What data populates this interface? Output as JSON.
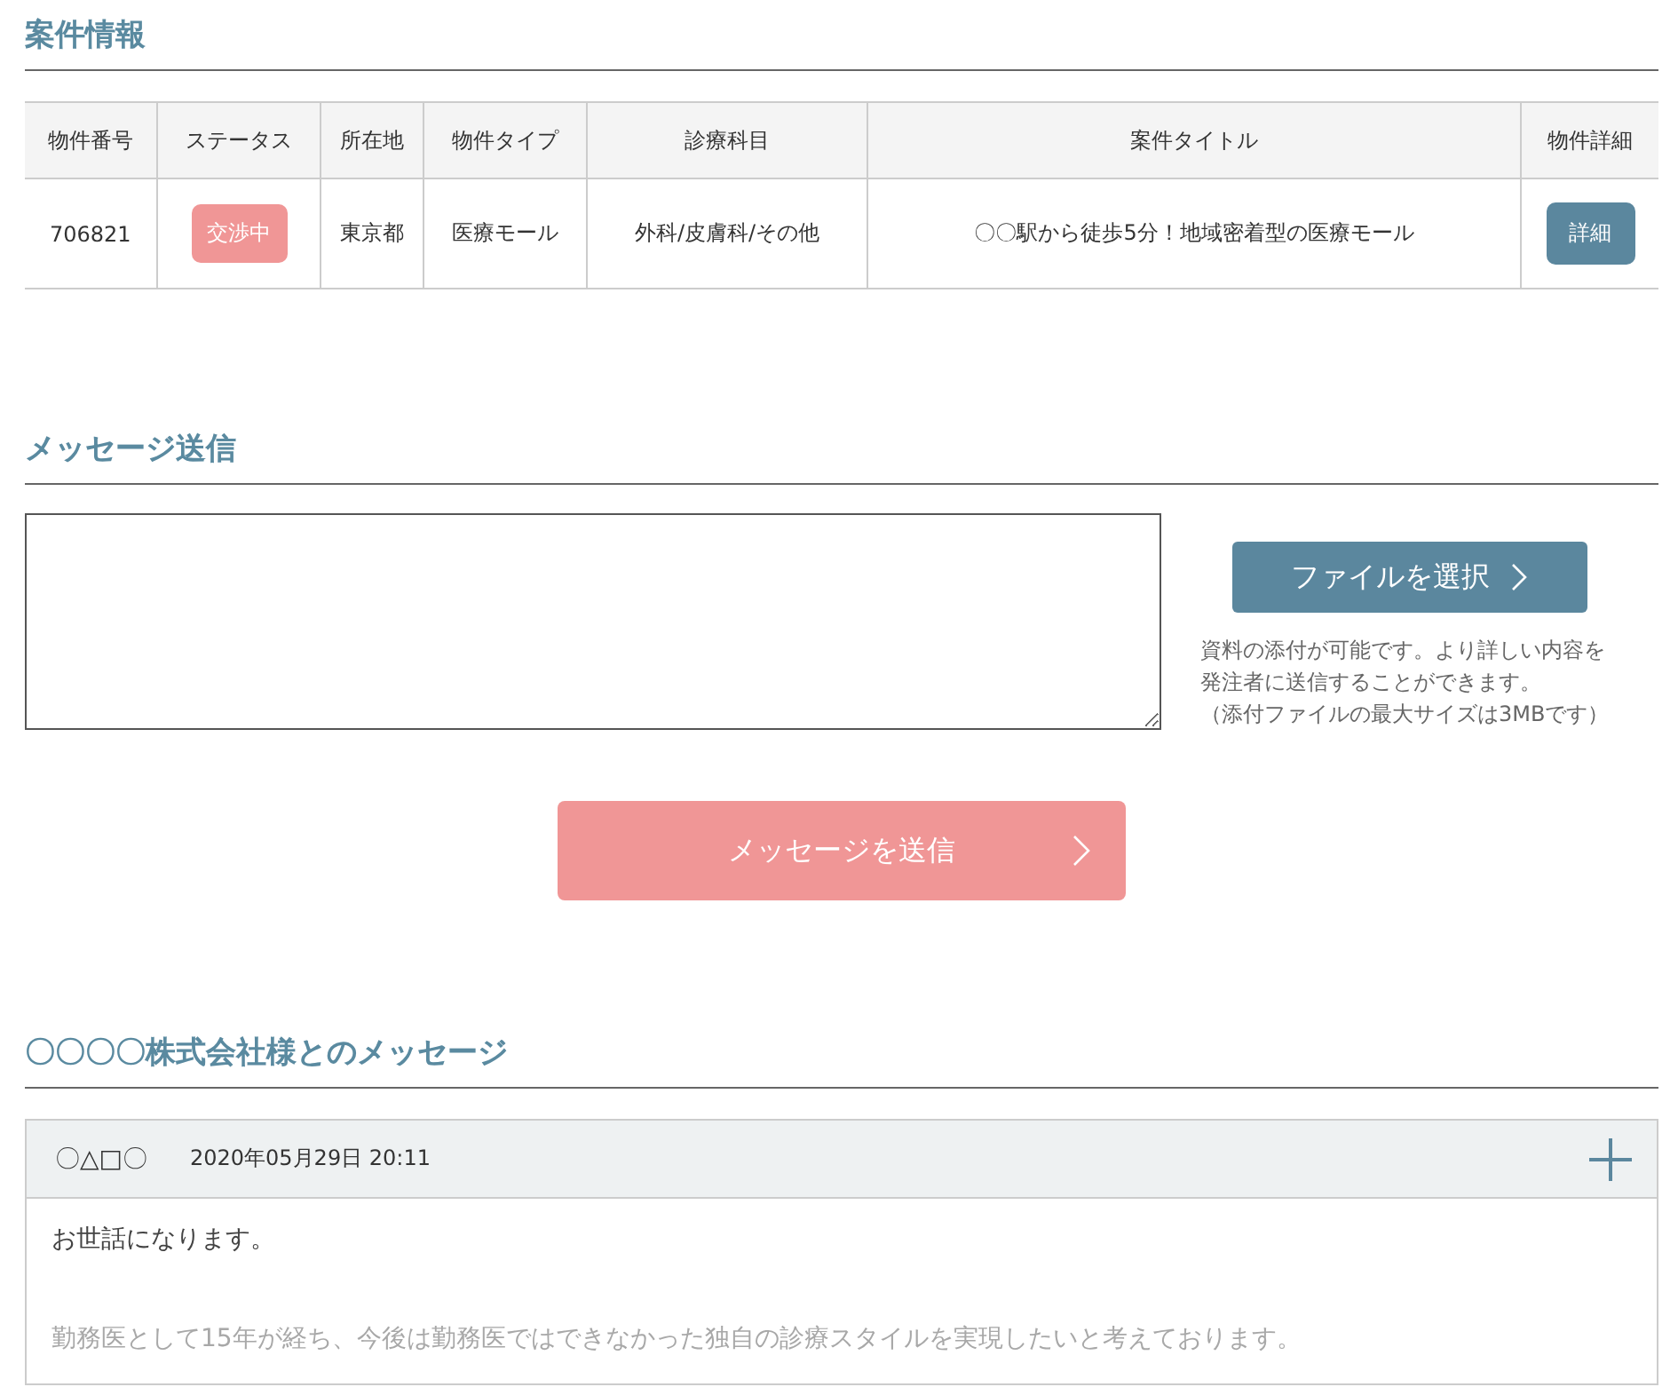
{
  "project_section": {
    "title": "案件情報",
    "table": {
      "columns": [
        "物件番号",
        "ステータス",
        "所在地",
        "物件タイプ",
        "診療科目",
        "案件タイトル",
        "物件詳細"
      ],
      "rows": [
        {
          "number": "706821",
          "status": "交渉中",
          "location": "東京都",
          "type": "医療モール",
          "departments": "外科/皮膚科/その他",
          "title": "〇〇駅から徒歩5分！地域密着型の医療モール",
          "detail_button": "詳細"
        }
      ]
    }
  },
  "message_section": {
    "title": "メッセージ送信",
    "file_button": "ファイルを選択",
    "file_note": [
      "資料の添付が可能です。より詳しい内容を",
      "発注者に送信することができます。",
      "（添付ファイルの最大サイズは3MBです）"
    ],
    "send_button": "メッセージを送信"
  },
  "history_section": {
    "title": "〇〇〇〇株式会社様とのメッセージ",
    "messages": [
      {
        "sender": "〇△□〇",
        "date": "2020年05月29日 20:11",
        "expanded": false,
        "body": [
          "お世話になります。",
          "勤務医として15年が経ち、今後は勤務医ではできなかった独自の診療スタイルを実現したいと考えております。"
        ]
      }
    ]
  }
}
